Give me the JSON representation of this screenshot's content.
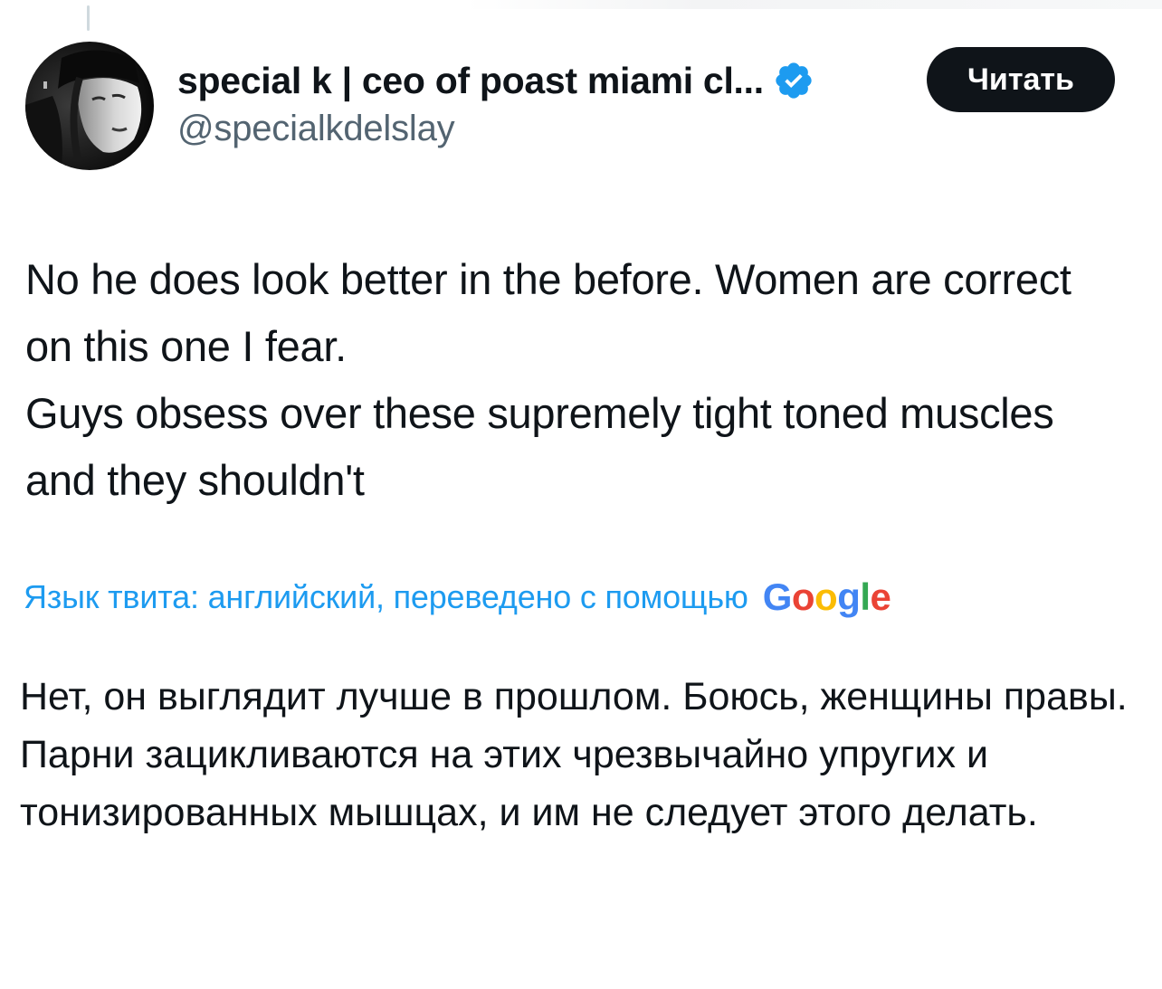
{
  "author": {
    "display_name": "special k | ceo of poast miami cl...",
    "handle": "@specialkdelslay",
    "verified": true,
    "avatar_icon": "user-avatar-photo"
  },
  "follow_button": {
    "label": "Читать"
  },
  "tweet": {
    "lines": [
      "No he does look better in the before. Women are correct on this one I fear.",
      "Guys obsess over these supremely tight toned muscles and they shouldn't"
    ]
  },
  "translation": {
    "label": "Язык твита: английский, переведено с помощью",
    "provider": "Google",
    "lines": [
      "Нет, он выглядит лучше в прошлом. Боюсь, женщины правы.",
      "Парни зацикливаются на этих чрезвычайно упругих и тонизированных мышцах, и им не следует этого делать."
    ]
  },
  "colors": {
    "text_primary": "#0f1419",
    "text_secondary": "#536471",
    "link": "#1d9bf0",
    "verified_badge": "#1d9bf0",
    "button_bg": "#0f1419"
  }
}
